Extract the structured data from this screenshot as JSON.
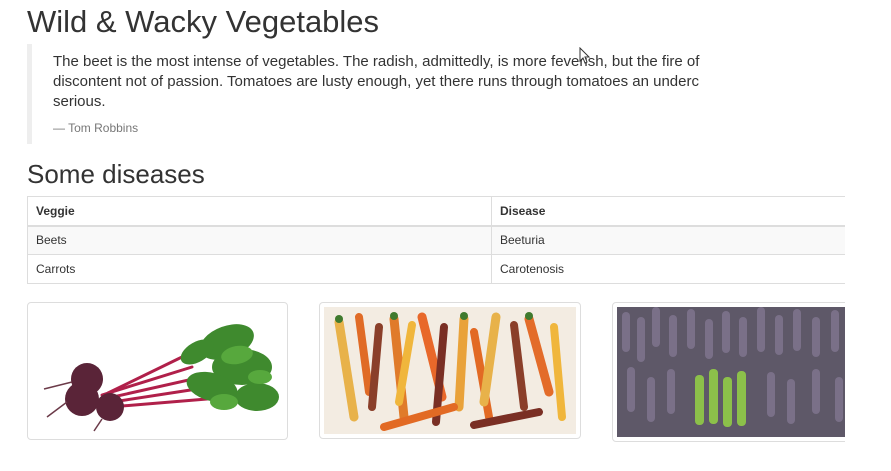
{
  "page": {
    "title": "Wild & Wacky Vegetables"
  },
  "quote": {
    "lines": [
      "The beet is the most intense of vegetables. The radish, admittedly, is more feverish, but the fire of",
      "discontent not of passion. Tomatoes are lusty enough, yet there runs through tomatoes an underc",
      "serious."
    ],
    "author": "— Tom Robbins"
  },
  "diseases": {
    "heading": "Some diseases",
    "columns": [
      "Veggie",
      "Disease"
    ],
    "rows": [
      [
        "Beets",
        "Beeturia"
      ],
      [
        "Carrots",
        "Carotenosis"
      ]
    ]
  },
  "images": {
    "items": [
      {
        "name": "beets-image",
        "icon": "beets"
      },
      {
        "name": "carrots-image",
        "icon": "carrots"
      },
      {
        "name": "asparagus-image",
        "icon": "asparagus"
      }
    ]
  },
  "colors": {
    "text": "#333333",
    "muted": "#777777",
    "border": "#dddddd",
    "stripe": "#f9f9f9"
  }
}
